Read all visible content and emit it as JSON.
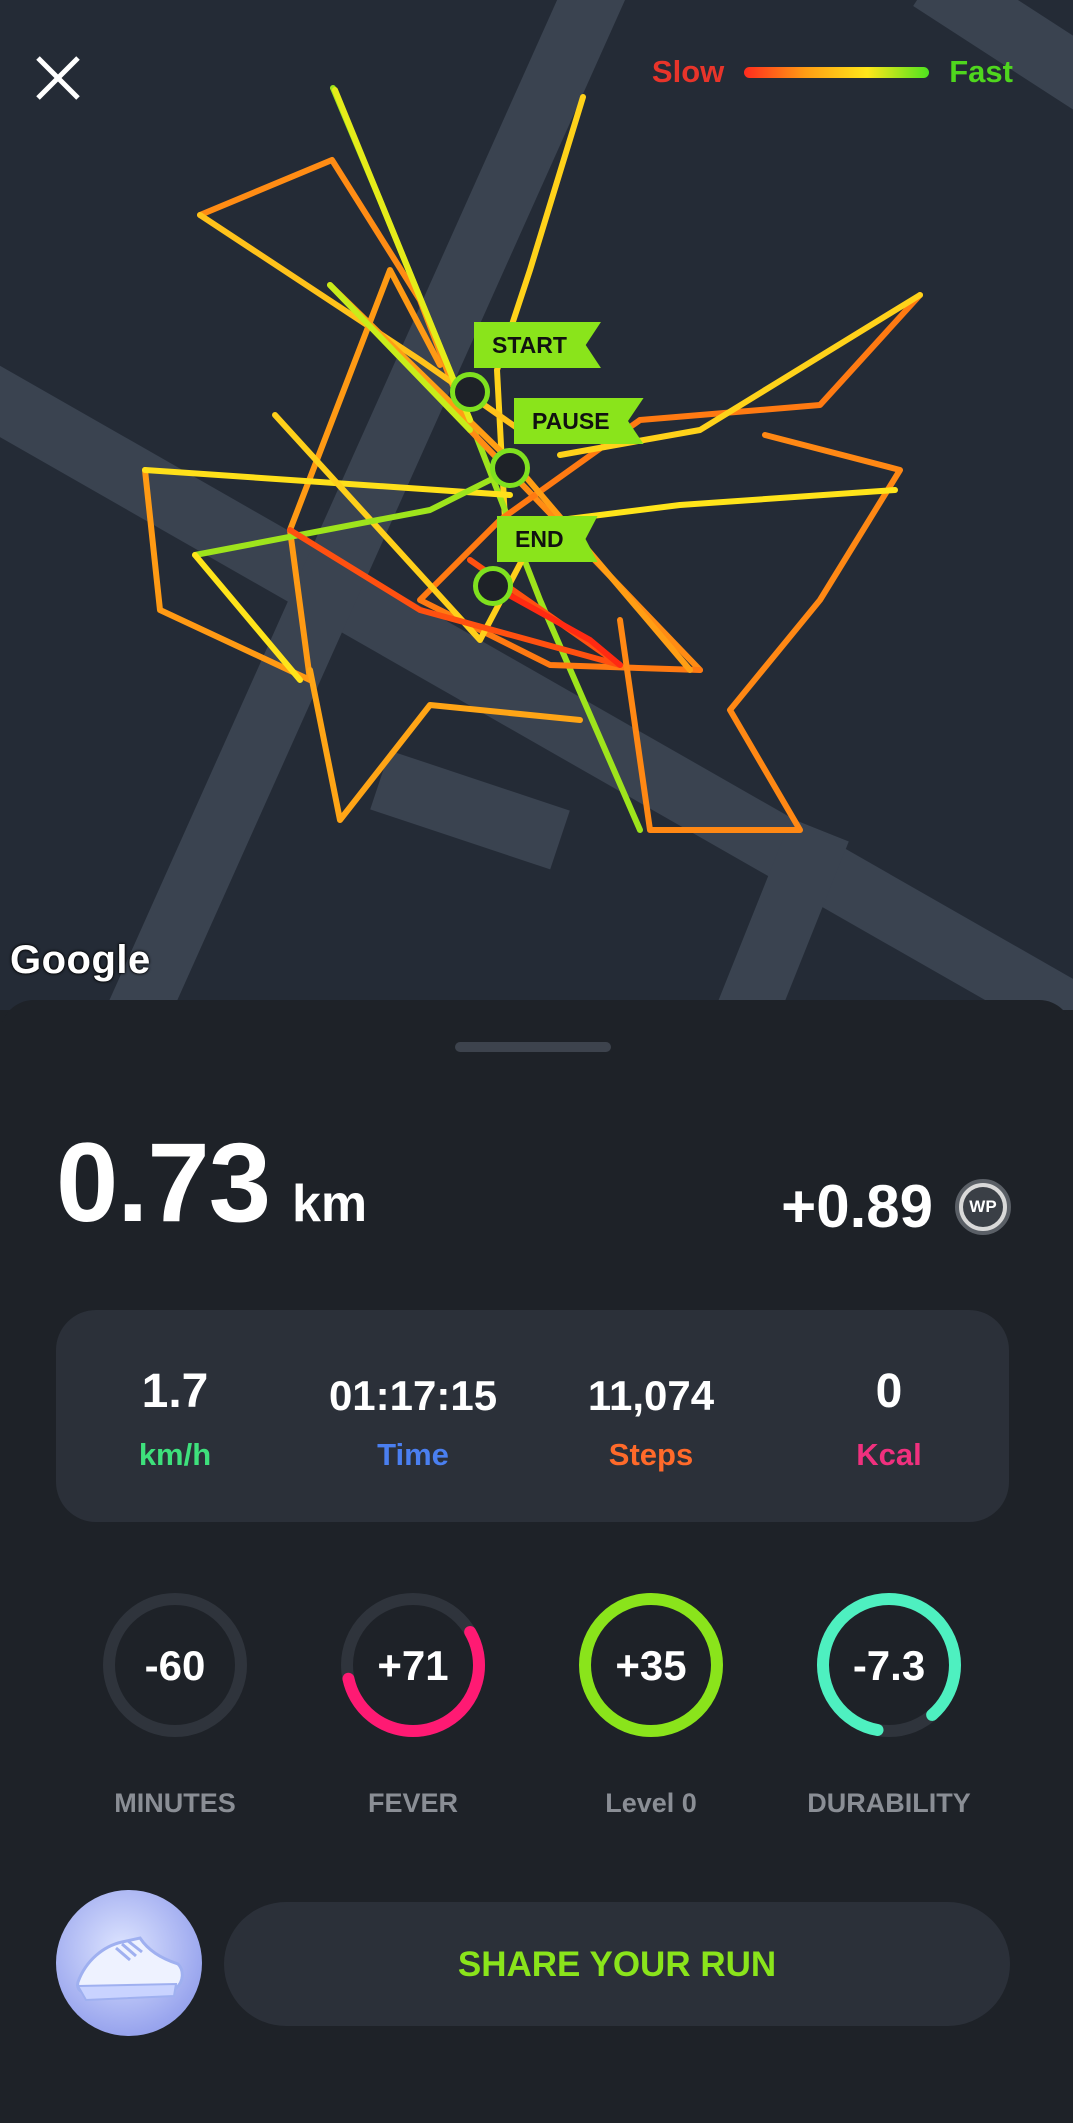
{
  "map": {
    "attribution": "Google",
    "legend": {
      "slow_label": "Slow",
      "fast_label": "Fast"
    },
    "markers": {
      "start": "START",
      "pause": "PAUSE",
      "end": "END"
    }
  },
  "summary": {
    "distance_value": "0.73",
    "distance_unit": "km",
    "wp_gain": "+0.89",
    "wp_badge": "WP"
  },
  "stats": [
    {
      "value": "1.7",
      "label": "km/h",
      "color": "#3ee07c"
    },
    {
      "value": "01:17:15",
      "label": "Time",
      "color": "#4a7ff0"
    },
    {
      "value": "11,074",
      "label": "Steps",
      "color": "#ff6a2a"
    },
    {
      "value": "0",
      "label": "Kcal",
      "color": "#f0307e"
    }
  ],
  "rings": [
    {
      "value": "-60",
      "label": "MINUTES",
      "color": "#2f343c",
      "fill": 0.0
    },
    {
      "value": "+71",
      "label": "FEVER",
      "color": "#ff1a73",
      "fill": 0.55
    },
    {
      "value": "+35",
      "label": "Level 0",
      "color": "#8ae41b",
      "fill": 1.0
    },
    {
      "value": "-7.3",
      "label": "DURABILITY",
      "color": "#4ef0c0",
      "fill": 0.86
    }
  ],
  "share_button": "SHARE YOUR RUN"
}
